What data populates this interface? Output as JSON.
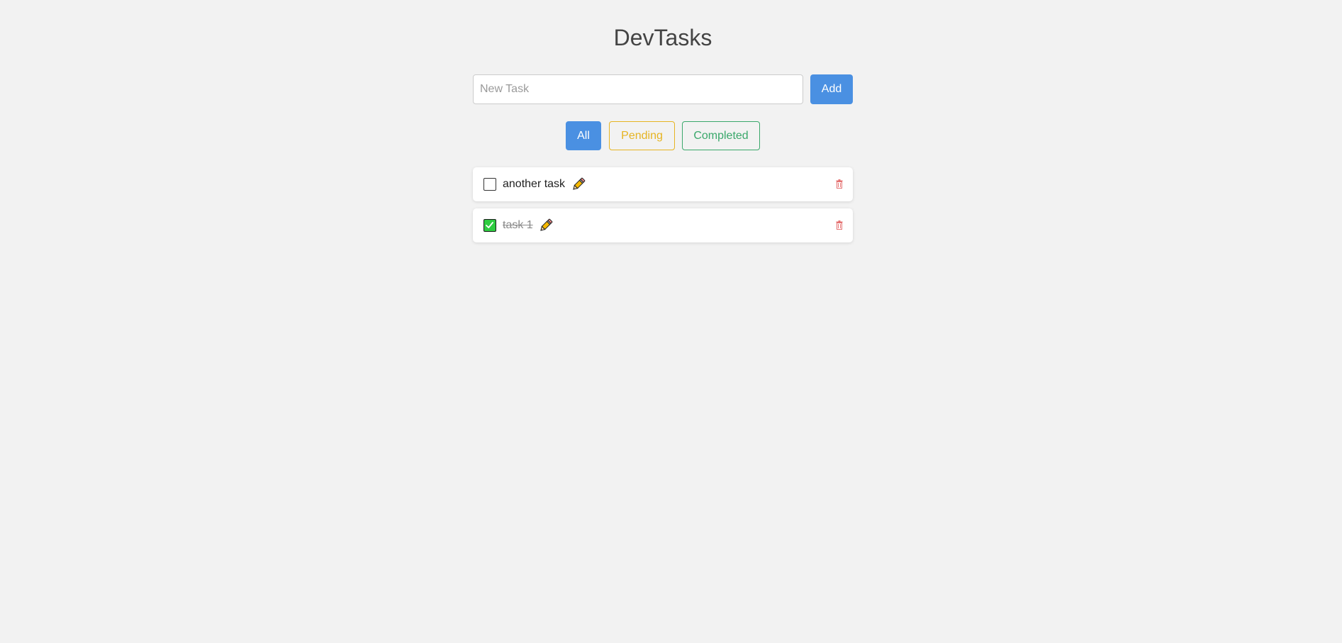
{
  "app": {
    "title": "DevTasks"
  },
  "new_task": {
    "placeholder": "New Task",
    "value": "",
    "add_label": "Add"
  },
  "filters": {
    "all_label": "All",
    "pending_label": "Pending",
    "completed_label": "Completed",
    "active": "All"
  },
  "tasks": [
    {
      "text": "another task",
      "completed": false
    },
    {
      "text": "task 1",
      "completed": true
    }
  ],
  "colors": {
    "accent": "#4a90e2",
    "pending": "#e6b422",
    "completed": "#3aa86b",
    "check_fill": "#2ecc40",
    "delete": "#e57373",
    "background": "#f2f2f2"
  },
  "icons": {
    "edit": "pencil-icon",
    "delete": "trash-icon",
    "check": "check-icon"
  }
}
